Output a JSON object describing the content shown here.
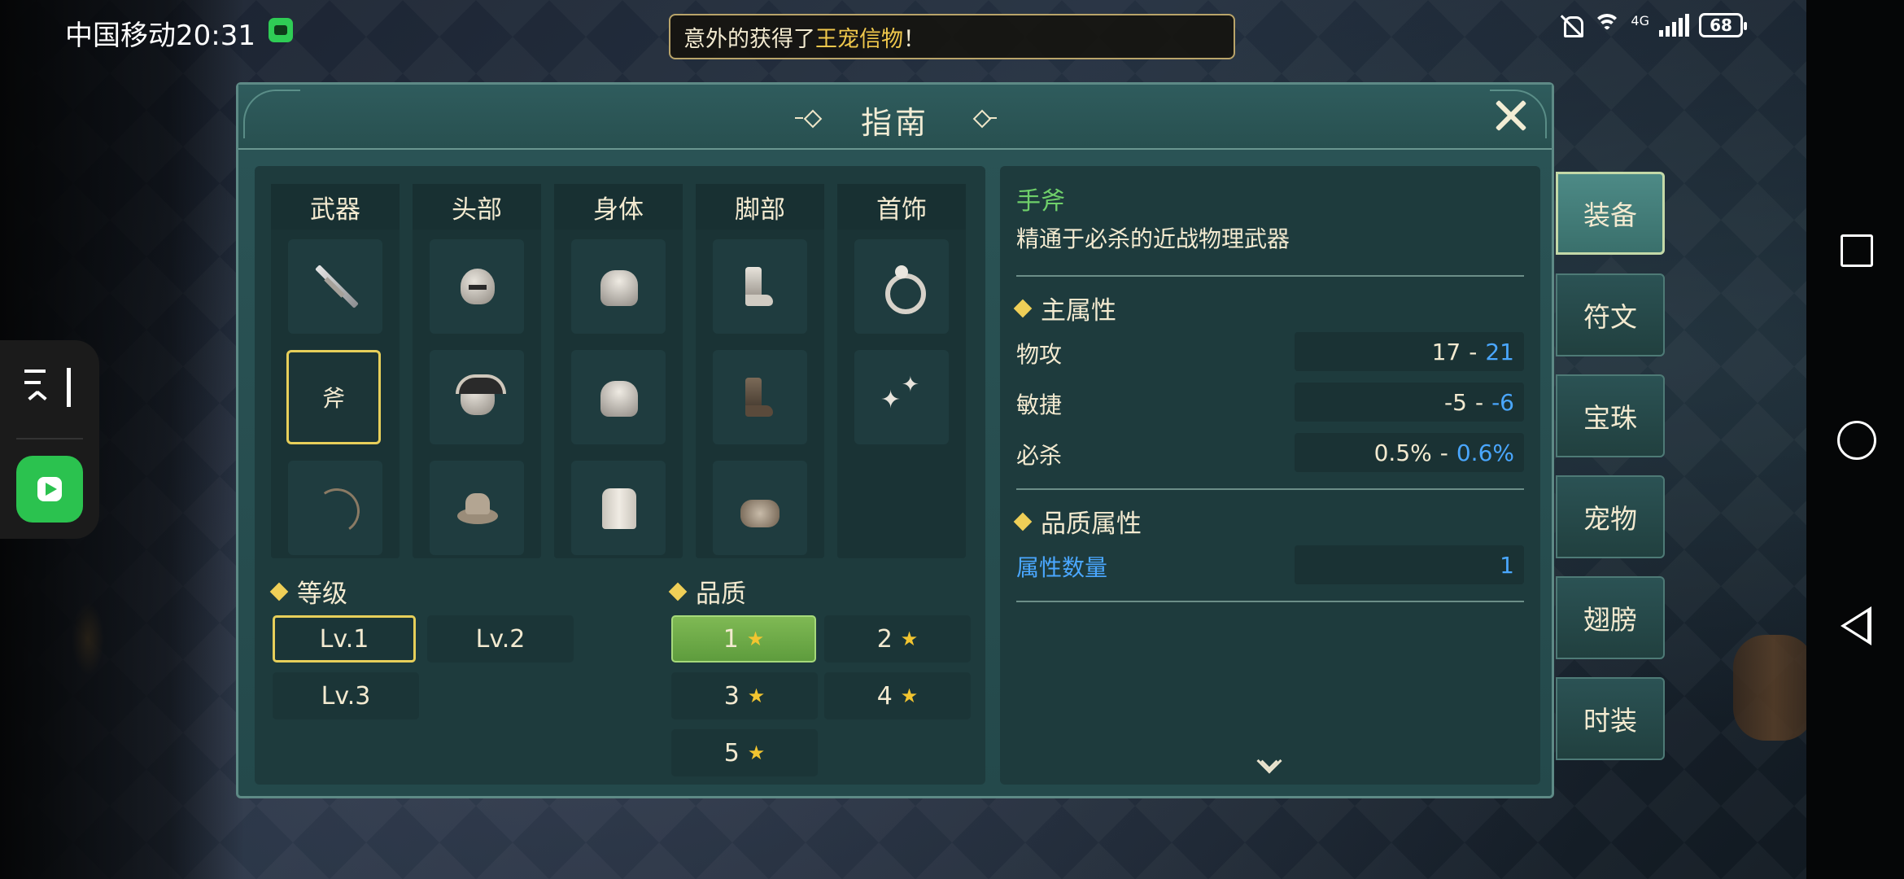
{
  "status_bar": {
    "carrier_time": "中国移动20:31",
    "network": "4G",
    "battery": "68"
  },
  "notice": {
    "prefix": "意外的获得了",
    "highlight": "王宠信物",
    "suffix": "！"
  },
  "panel": {
    "title": "指南"
  },
  "categories": [
    {
      "label": "武器",
      "items": [
        "sword",
        "axe",
        "bow"
      ]
    },
    {
      "label": "头部",
      "items": [
        "helm",
        "horned-helm",
        "hat"
      ]
    },
    {
      "label": "身体",
      "items": [
        "plate-armor",
        "heavy-armor",
        "robe"
      ]
    },
    {
      "label": "脚部",
      "items": [
        "steel-boots",
        "leather-boots",
        "shoes"
      ]
    },
    {
      "label": "首饰",
      "items": [
        "ring",
        "pendant"
      ]
    }
  ],
  "selected_slot_label": "斧",
  "level": {
    "title": "等级",
    "options": [
      "Lv.1",
      "Lv.2",
      "Lv.3"
    ],
    "selected": "Lv.1"
  },
  "quality": {
    "title": "品质",
    "options": [
      "1",
      "2",
      "3",
      "4",
      "5"
    ],
    "selected": "1"
  },
  "detail": {
    "name": "手斧",
    "description": "精通于必杀的近战物理武器",
    "main_attr_title": "主属性",
    "main_attrs": [
      {
        "label": "物攻",
        "min": "17",
        "sep": "-",
        "max": "21"
      },
      {
        "label": "敏捷",
        "min": "-5",
        "sep": "-",
        "max": "-6"
      },
      {
        "label": "必杀",
        "min": "0.5%",
        "sep": "-",
        "max": "0.6%"
      }
    ],
    "quality_attr_title": "品质属性",
    "quality_attrs": [
      {
        "label": "属性数量",
        "value": "1"
      }
    ]
  },
  "side_tabs": [
    "装备",
    "符文",
    "宝珠",
    "宠物",
    "翅膀",
    "时装"
  ],
  "side_tab_active": "装备",
  "colors": {
    "accent_gold": "#e7cf5a",
    "name_green": "#6fd06a",
    "value_blue": "#4aa7ff",
    "selected_green": "#6fae48"
  }
}
